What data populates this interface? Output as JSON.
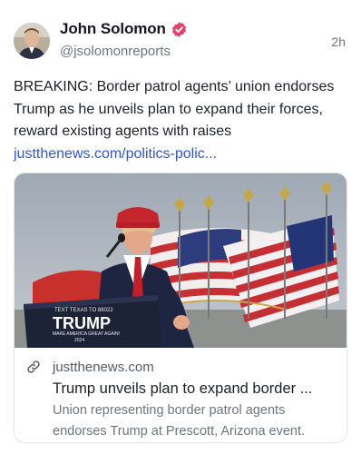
{
  "post": {
    "author": {
      "display_name": "John Solomon",
      "handle": "@jsolomonreports",
      "verified_icon": "verified-badge-icon",
      "verified_color": "#e2406a"
    },
    "timestamp": "2h",
    "text": "BREAKING: Border patrol agents’ union endorses Trump as he unveils plan to expand their forces, reward existing agents with raises ",
    "link_text": "justthenews.com/politics-polic...",
    "link_color": "#2f55d4"
  },
  "card": {
    "image_podium_lines": [
      "TEXT TEXAS TO 88022",
      "TRUMP",
      "MAKE AMERICA GREAT AGAIN!",
      "2024"
    ],
    "domain": "justthenews.com",
    "title": "Trump unveils plan to expand border ...",
    "description": "Union representing border patrol agents endorses Trump at Prescott, Arizona event."
  }
}
